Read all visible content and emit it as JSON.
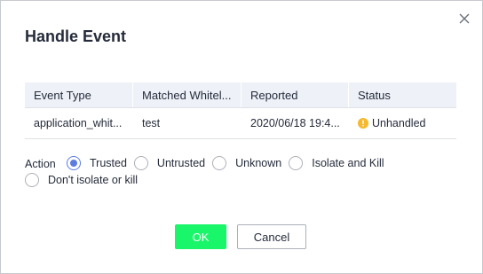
{
  "dialog": {
    "title": "Handle Event",
    "close_icon": "close-icon"
  },
  "table": {
    "columns": [
      "Event Type",
      "Matched Whitel...",
      "Reported",
      "Status"
    ],
    "rows": [
      {
        "event_type": "application_whit...",
        "matched": "test",
        "reported": "2020/06/18 19:4...",
        "status": "Unhandled",
        "status_icon": "warning-icon",
        "status_color": "#f6b82d"
      }
    ]
  },
  "action": {
    "label": "Action",
    "options": [
      "Trusted",
      "Untrusted",
      "Unknown",
      "Isolate and Kill",
      "Don't isolate or kill"
    ],
    "selected": "Trusted"
  },
  "buttons": {
    "ok": "OK",
    "cancel": "Cancel"
  },
  "colors": {
    "accent": "#5e7ce0",
    "ok_button": "#19f66a",
    "header_bg": "#eef1f7"
  }
}
